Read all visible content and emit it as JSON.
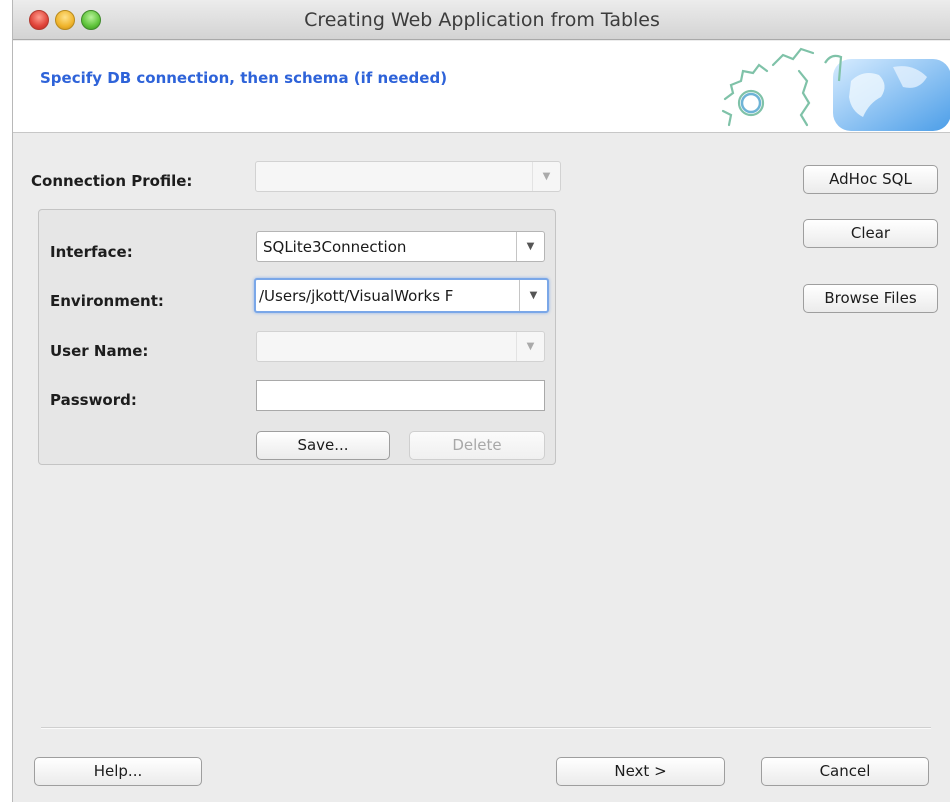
{
  "window": {
    "title": "Creating Web Application from Tables"
  },
  "header": {
    "subtitle": "Specify DB connection, then schema (if needed)"
  },
  "form": {
    "connection_profile": {
      "label": "Connection Profile:",
      "value": ""
    },
    "interface": {
      "label": "Interface:",
      "value": "SQLite3Connection"
    },
    "environment": {
      "label": "Environment:",
      "value": "/Users/jkott/VisualWorks F"
    },
    "user_name": {
      "label": "User Name:",
      "value": ""
    },
    "password": {
      "label": "Password:",
      "value": ""
    },
    "save_label": "Save...",
    "delete_label": "Delete"
  },
  "side_buttons": {
    "adhoc_sql": "AdHoc SQL",
    "clear": "Clear",
    "browse_files": "Browse Files"
  },
  "footer": {
    "help": "Help...",
    "next": "Next >",
    "cancel": "Cancel"
  },
  "icons": {
    "dropdown_arrow": "▼",
    "header_art": "gears-globe-icon"
  },
  "colors": {
    "subtitle": "#2e63d9",
    "focus": "#7aa7e8"
  }
}
